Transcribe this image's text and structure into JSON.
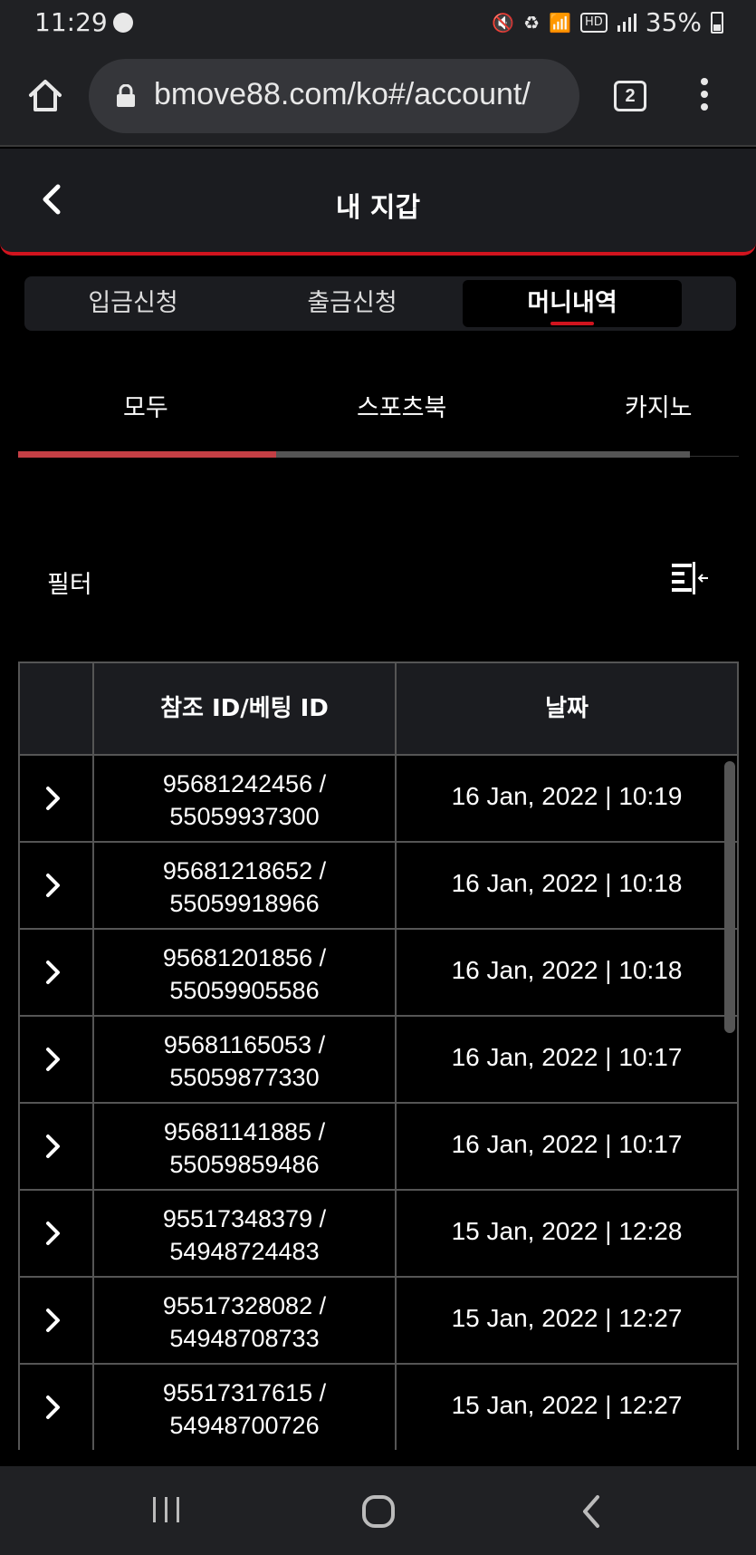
{
  "status_bar": {
    "time": "11:29",
    "battery": "35%",
    "hd_badge": "HD"
  },
  "browser": {
    "url": "bmove88.com/ko#/account/",
    "tab_count": "2"
  },
  "header": {
    "title": "내 지갑"
  },
  "seg_tabs": [
    {
      "label": "입금신청",
      "active": false
    },
    {
      "label": "출금신청",
      "active": false
    },
    {
      "label": "머니내역",
      "active": true
    }
  ],
  "category_tabs": [
    {
      "label": "모두",
      "active": true
    },
    {
      "label": "스포츠북",
      "active": false
    },
    {
      "label": "카지노",
      "active": false
    }
  ],
  "filter": {
    "label": "필터"
  },
  "table": {
    "columns": [
      "",
      "참조 ID/베팅 ID",
      "날짜"
    ],
    "rows": [
      {
        "ref_id": "95681242456 /",
        "bet_id": "55059937300",
        "date": "16 Jan, 2022 | 10:19"
      },
      {
        "ref_id": "95681218652 /",
        "bet_id": "55059918966",
        "date": "16 Jan, 2022 | 10:18"
      },
      {
        "ref_id": "95681201856 /",
        "bet_id": "55059905586",
        "date": "16 Jan, 2022 | 10:18"
      },
      {
        "ref_id": "95681165053 /",
        "bet_id": "55059877330",
        "date": "16 Jan, 2022 | 10:17"
      },
      {
        "ref_id": "95681141885 /",
        "bet_id": "55059859486",
        "date": "16 Jan, 2022 | 10:17"
      },
      {
        "ref_id": "95517348379 /",
        "bet_id": "54948724483",
        "date": "15 Jan, 2022 | 12:28"
      },
      {
        "ref_id": "95517328082 /",
        "bet_id": "54948708733",
        "date": "15 Jan, 2022 | 12:27"
      },
      {
        "ref_id": "95517317615 /",
        "bet_id": "54948700726",
        "date": "15 Jan, 2022 | 12:27"
      }
    ]
  },
  "colors": {
    "accent": "#d1141e",
    "panel": "#1b1c20",
    "background": "#000000"
  },
  "icons": [
    "home-icon",
    "lock-icon",
    "more-vert-icon",
    "back-chevron-icon",
    "filter-icon",
    "chevron-right-icon",
    "recents-icon",
    "home-nav-icon",
    "back-nav-icon"
  ]
}
